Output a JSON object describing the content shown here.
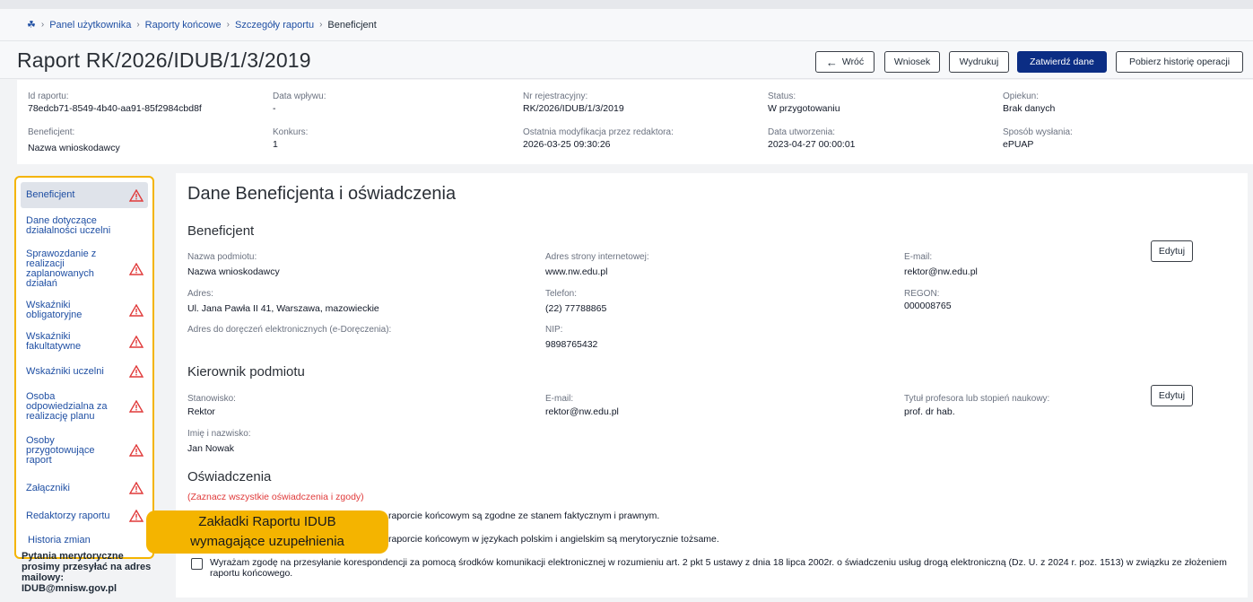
{
  "breadcrumb": {
    "home_icon": "home-icon",
    "items": [
      "Panel użytkownika",
      "Raporty końcowe",
      "Szczegóły raportu",
      "Beneficjent"
    ],
    "separator": "›"
  },
  "header": {
    "title": "Raport RK/2026/IDUB/1/3/2019",
    "buttons": {
      "back": "Wróć",
      "application": "Wniosek",
      "print": "Wydrukuj",
      "approve": "Zatwierdź dane",
      "history": "Pobierz historię operacji"
    }
  },
  "info": {
    "id_label": "Id raportu:",
    "id_value": "78edcb71-8549-4b40-aa91-85f2984cbd8f",
    "received_label": "Data wpływu:",
    "received_value": "-",
    "regno_label": "Nr rejestracyjny:",
    "regno_value": "RK/2026/IDUB/1/3/2019",
    "status_label": "Status:",
    "status_value": "W przygotowaniu",
    "keeper_label": "Opiekun:",
    "keeper_value": "Brak danych",
    "beneficiary_label": "Beneficjent:",
    "beneficiary_value": "Nazwa wnioskodawcy",
    "contest_label": "Konkurs:",
    "contest_value": "1",
    "lastmod_label": "Ostatnia modyfikacja przez redaktora:",
    "lastmod_value": "2026-03-25 09:30:26",
    "created_label": "Data utworzenia:",
    "created_value": "2023-04-27 00:00:01",
    "sendmode_label": "Sposób wysłania:",
    "sendmode_value": "ePUAP"
  },
  "sidebar": {
    "items": [
      {
        "label": "Beneficjent",
        "warning": true
      },
      {
        "label": "Dane dotyczące działalności uczelni",
        "warning": false
      },
      {
        "label": "Sprawozdanie z realizacji zaplanowanych działań",
        "warning": true
      },
      {
        "label": "Wskaźniki obligatoryjne",
        "warning": true
      },
      {
        "label": "Wskaźniki fakultatywne",
        "warning": true
      },
      {
        "label": "Wskaźniki uczelni",
        "warning": true
      },
      {
        "label": "Osoba odpowiedzialna za realizację planu",
        "warning": true
      },
      {
        "label": "Osoby przygotowujące raport",
        "warning": true
      },
      {
        "label": "Załączniki",
        "warning": true
      },
      {
        "label": "Redaktorzy raportu",
        "warning": true
      }
    ],
    "history": "Historia zmian",
    "mail_note": "Pytania merytoryczne prosimy przesyłać na adres mailowy: IDUB@mnisw.gov.pl",
    "warning_color": "#e03a3a"
  },
  "tooltip": {
    "line1": "Zakładki Raportu IDUB",
    "line2": "wymagające uzupełnienia",
    "color": "#f4b400"
  },
  "main": {
    "title": "Dane Beneficjenta i oświadczenia",
    "beneficiary": {
      "section": "Beneficjent",
      "edit": "Edytuj",
      "name_label": "Nazwa podmiotu:",
      "name_value": "Nazwa wnioskodawcy",
      "www_label": "Adres strony internetowej:",
      "www_value": "www.nw.edu.pl",
      "email_label": "E-mail:",
      "email_value": "rektor@nw.edu.pl",
      "address_label": "Adres:",
      "address_value": "Ul. Jana Pawła II 41, Warszawa, mazowieckie",
      "phone_label": "Telefon:",
      "phone_value": "(22) 77788865",
      "regon_label": "REGON:",
      "regon_value": "000008765",
      "edelivery_label": "Adres do doręczeń elektronicznych (e-Doręczenia):",
      "nip_label": "NIP:",
      "nip_value": "9898765432"
    },
    "head": {
      "section": "Kierownik podmiotu",
      "edit": "Edytuj",
      "position_label": "Stanowisko:",
      "position_value": "Rektor",
      "email_label": "E-mail:",
      "email_value": "rektor@nw.edu.pl",
      "degree_label": "Tytuł profesora lub stopień naukowy:",
      "degree_value": "prof. dr hab.",
      "name_label": "Imię i nazwisko:",
      "name_value": "Jan Nowak"
    },
    "declarations": {
      "section": "Oświadczenia",
      "hint": "(Zaznacz wszystkie oświadczenia i zgody)",
      "d1_visible": "raporcie końcowym są zgodne ze stanem faktycznym i prawnym.",
      "d2_visible": "raporcie końcowym w językach polskim i angielskim są merytorycznie tożsame.",
      "d3": "Wyrażam zgodę na przesyłanie korespondencji za pomocą środków komunikacji elektronicznej w rozumieniu art. 2 pkt 5 ustawy z dnia 18 lipca 2002r. o świadczeniu usług drogą elektroniczną (Dz. U. z 2024 r. poz. 1513) w związku ze złożeniem raportu końcowego."
    }
  }
}
